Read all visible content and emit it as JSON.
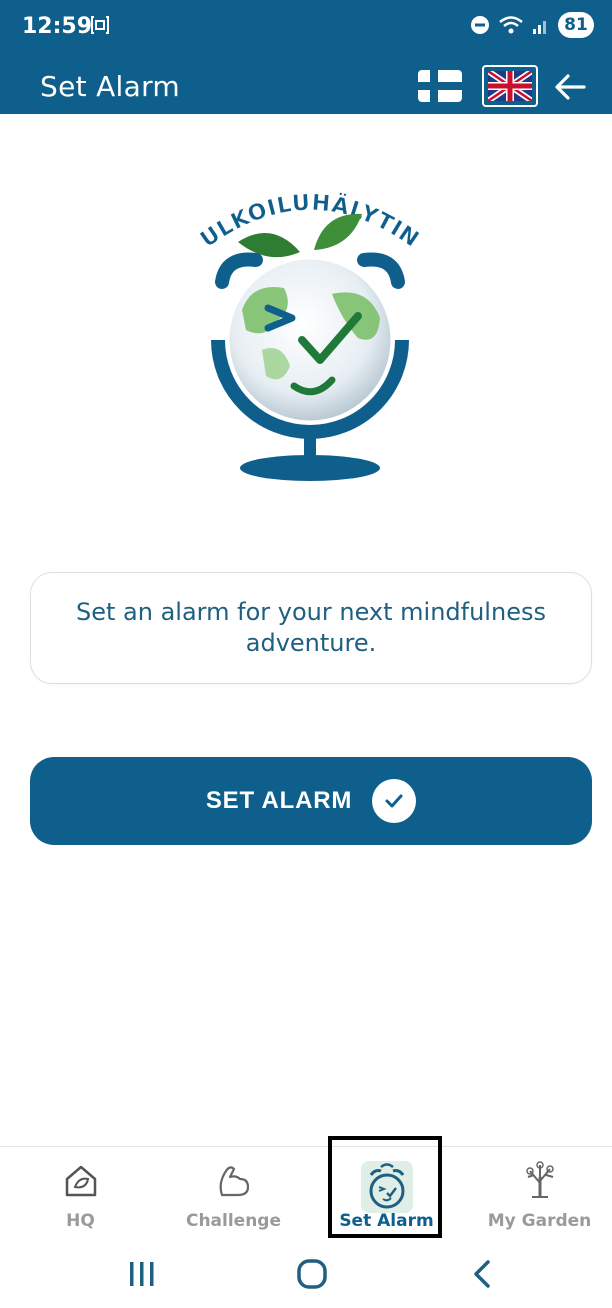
{
  "status_bar": {
    "time": "12:59",
    "battery": "81",
    "icons": [
      "screenshot-icon",
      "do-not-disturb-icon",
      "wifi-icon",
      "signal-icon",
      "battery-icon"
    ]
  },
  "app_bar": {
    "title": "Set Alarm",
    "languages": [
      "finnish-flag",
      "uk-flag"
    ],
    "back_icon": "arrow-left-icon"
  },
  "logo": {
    "text": "ULKOILUHÄLYTIN"
  },
  "message": {
    "text": "Set an alarm for your next mindfulness adventure."
  },
  "button": {
    "label": "SET ALARM",
    "icon": "check-icon"
  },
  "bottom_nav": {
    "items": [
      {
        "label": "HQ",
        "icon": "house-leaf-icon",
        "active": false
      },
      {
        "label": "Challenge",
        "icon": "flexed-arm-icon",
        "active": false
      },
      {
        "label": "Set Alarm",
        "icon": "alarm-clock-icon",
        "active": true
      },
      {
        "label": "My Garden",
        "icon": "tree-icon",
        "active": false
      }
    ]
  },
  "system_nav": [
    "recent-apps-icon",
    "home-icon",
    "back-chevron-icon"
  ],
  "colors": {
    "primary": "#0f5f8c",
    "text_blue": "#1f5f80",
    "inactive": "#9a9a9a",
    "leaf_green": "#3e8e3a"
  }
}
